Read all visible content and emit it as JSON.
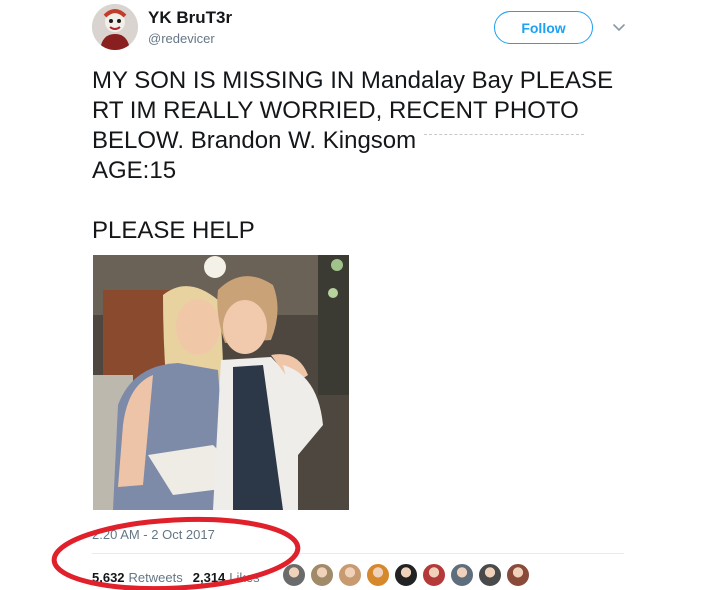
{
  "author": {
    "display_name": "YK BruT3r",
    "handle": "@redevicer"
  },
  "follow_button": {
    "label": "Follow"
  },
  "tweet": {
    "lines": [
      "MY SON IS MISSING IN Mandalay Bay PLEASE",
      "RT IM REALLY WORRIED, RECENT PHOTO",
      "BELOW. Brandon W. Kingsom",
      "AGE:15",
      "PLEASE HELP"
    ]
  },
  "timestamp": "2:20 AM - 2 Oct 2017",
  "stats": {
    "retweets_count": "5,632",
    "retweets_label": "Retweets",
    "likes_count": "2,314",
    "likes_label": "Likes"
  },
  "liker_avatars": [
    {
      "icon": "avatar-icon",
      "color": "#6b6b6b"
    },
    {
      "icon": "avatar-icon",
      "color": "#a08a68"
    },
    {
      "icon": "avatar-icon",
      "color": "#c89a70"
    },
    {
      "icon": "avatar-icon",
      "color": "#d6882c"
    },
    {
      "icon": "avatar-icon",
      "color": "#222222"
    },
    {
      "icon": "avatar-icon",
      "color": "#b43a3a"
    },
    {
      "icon": "avatar-icon",
      "color": "#5e6e7c"
    },
    {
      "icon": "avatar-icon",
      "color": "#4a4a4a"
    },
    {
      "icon": "avatar-icon",
      "color": "#8a4a3a"
    }
  ],
  "colors": {
    "accent": "#1da1f2",
    "secondary_text": "#657786",
    "annotation_circle": "#e0202a"
  }
}
